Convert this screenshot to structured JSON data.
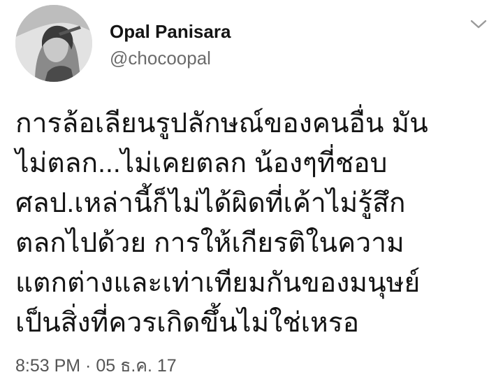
{
  "user": {
    "display_name": "Opal Panisara",
    "handle": "@chocoopal",
    "avatar_icon": "profile-photo-grayscale"
  },
  "menu": {
    "icon": "chevron-down-icon"
  },
  "tweet": {
    "lines": [
      "การล้อเลียนรูปลักษณ์ของคนอื่น มัน",
      "ไม่ตลก...ไม่เคยตลก น้องๆที่ชอบ",
      "ศลป.เหล่านี้ก็ไม่ได้ผิดที่เค้าไม่รู้สึก",
      "ตลกไปด้วย การให้เกียรติในความ",
      "แตกต่างและเท่าเทียมกันของมนุษย์",
      "เป็นสิ่งที่ควรเกิดขึ้นไม่ใช่เหรอ"
    ],
    "timestamp": "8:53 PM · 05 ธ.ค. 17"
  },
  "colors": {
    "text": "#141414",
    "secondary": "#6b6b6b",
    "background": "#ffffff"
  }
}
